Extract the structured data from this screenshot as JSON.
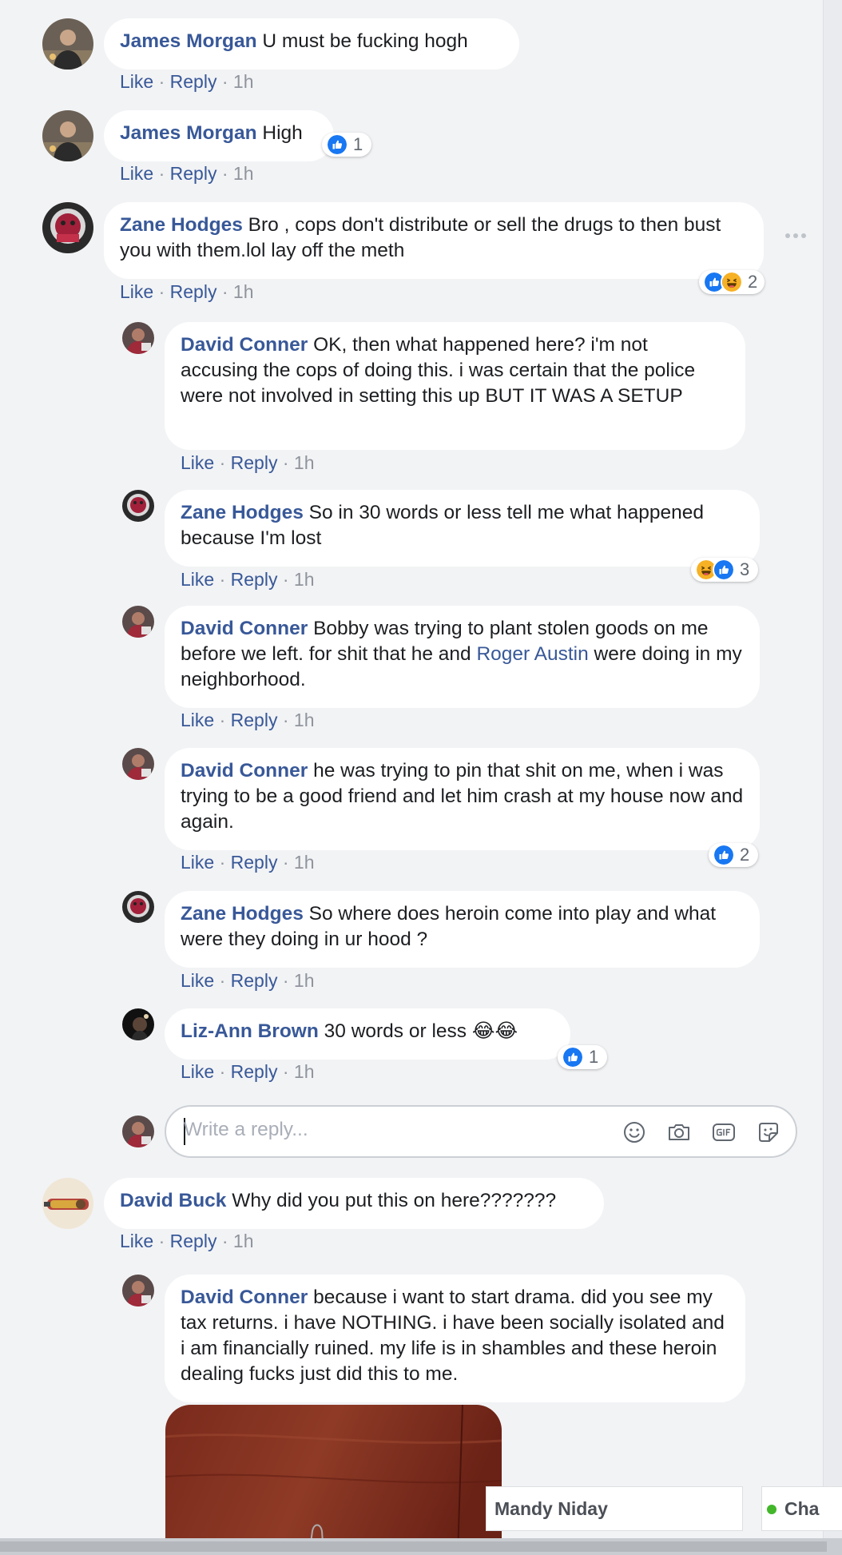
{
  "actions": {
    "like": "Like",
    "reply": "Reply",
    "separator": "·"
  },
  "comments": [
    {
      "author": "James Morgan",
      "text": "U must be fucking hogh",
      "time": "1h"
    },
    {
      "author": "James Morgan",
      "text": "High",
      "time": "1h",
      "reactions": {
        "icons": [
          "like"
        ],
        "count": "1"
      }
    },
    {
      "author": "Zane Hodges",
      "text": "Bro , cops don't distribute or sell the drugs to then bust you with them.lol lay off the meth",
      "time": "1h",
      "reactions": {
        "icons": [
          "like",
          "haha"
        ],
        "count": "2"
      }
    },
    {
      "author": "David Conner",
      "text": "OK, then what happened here? i'm not accusing the cops of doing this. i was certain that the police were not involved in setting this up BUT IT WAS A SETUP",
      "time": "1h"
    },
    {
      "author": "Zane Hodges",
      "text": "So in 30 words or less tell me what happened because I'm lost",
      "time": "1h",
      "reactions": {
        "icons": [
          "haha",
          "like"
        ],
        "count": "3"
      }
    },
    {
      "author": "David Conner",
      "text_before": "Bobby was trying to plant stolen goods on me before we left. for shit that he and",
      "mention": "Roger Austin",
      "text_after": "were doing in my neighborhood.",
      "time": "1h"
    },
    {
      "author": "David Conner",
      "text": "he was trying to pin that shit on me, when i was trying to be a good friend and let him crash at my house now and again.",
      "time": "1h",
      "reactions": {
        "icons": [
          "like"
        ],
        "count": "2"
      }
    },
    {
      "author": "Zane Hodges",
      "text": "So where does heroin come into play and what were they doing in ur hood ?",
      "time": "1h"
    },
    {
      "author": "Liz-Ann Brown",
      "text": "30 words or less",
      "emoji": "😂😂",
      "time": "1h",
      "reactions": {
        "icons": [
          "like"
        ],
        "count": "1"
      }
    },
    {
      "author": "David Buck",
      "text": "Why did you put this on here???????",
      "time": "1h"
    },
    {
      "author": "David Conner",
      "text": "because i want to start drama. did you see my tax returns. i have NOTHING. i have been socially isolated and i am financially ruined. my life is in shambles and these heroin dealing fucks just did this to me.",
      "time": ""
    }
  ],
  "reply_box": {
    "placeholder": "Write a reply..."
  },
  "chat": {
    "tab_name": "Mandy Niday",
    "sidebar_label": "Cha"
  },
  "colors": {
    "link": "#385898",
    "meta": "#90949c",
    "like": "#1877f2",
    "haha": "#f7b125",
    "online": "#42b72a"
  },
  "icons": [
    "more-options-icon",
    "like-reaction-icon",
    "haha-reaction-icon",
    "emoji-icon",
    "camera-icon",
    "gif-icon",
    "sticker-icon",
    "online-dot-icon"
  ]
}
